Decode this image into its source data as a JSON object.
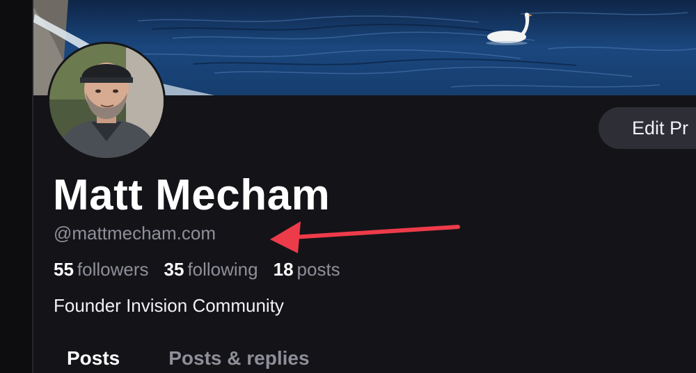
{
  "profile": {
    "display_name": "Matt Mecham",
    "handle": "@mattmecham.com",
    "bio": "Founder Invision Community",
    "edit_button_label": "Edit Pr"
  },
  "stats": {
    "followers_count": "55",
    "followers_label": "followers",
    "following_count": "35",
    "following_label": "following",
    "posts_count": "18",
    "posts_label": "posts"
  },
  "tabs": [
    {
      "label": "Posts",
      "active": true
    },
    {
      "label": "Posts & replies",
      "active": false
    }
  ],
  "icons": {
    "annotation": "red-arrow-icon"
  },
  "colors": {
    "background": "#141418",
    "muted_text": "#8e8f99",
    "button_bg": "#2e2f36",
    "annotation_red": "#ee3b4a"
  }
}
